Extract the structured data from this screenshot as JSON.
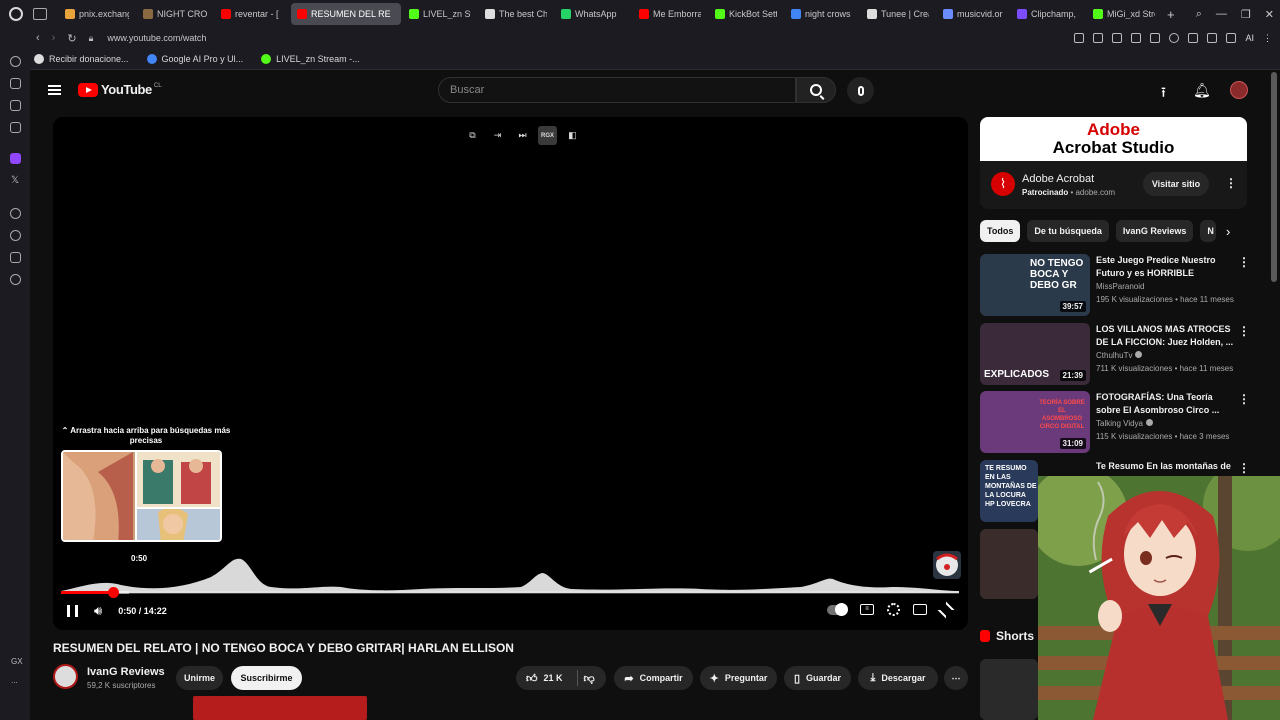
{
  "browser": {
    "tabs": [
      {
        "label": "pnix.exchang",
        "color": "#e8a33d"
      },
      {
        "label": "NIGHT CRO",
        "color": "#8a6a40"
      },
      {
        "label": "reventar - [",
        "color": "#ff0000"
      },
      {
        "label": "RESUMEN DEL RE",
        "color": "#ff0000",
        "active": true
      },
      {
        "label": "LIVEL_zn St",
        "color": "#53fc18"
      },
      {
        "label": "The best Ch",
        "color": "#dddddd"
      },
      {
        "label": "WhatsApp",
        "color": "#25d366"
      },
      {
        "label": "Me Emborra",
        "color": "#ff0000"
      },
      {
        "label": "KickBot Sett",
        "color": "#53fc18"
      },
      {
        "label": "night crows",
        "color": "#4285f4"
      },
      {
        "label": "Tunee | Crea",
        "color": "#dddddd"
      },
      {
        "label": "musicvid.or",
        "color": "#6b8cff"
      },
      {
        "label": "Clipchamp, a",
        "color": "#7b4dff"
      },
      {
        "label": "MiGi_xd Stre",
        "color": "#53fc18"
      }
    ],
    "url": "www.youtube.com/watch",
    "ai_label": "AI",
    "bookmarks": [
      {
        "label": "Recibir donacione...",
        "color": "#dddddd"
      },
      {
        "label": "Google AI Pro y Ul...",
        "color": "#4285f4"
      },
      {
        "label": "LIVEL_zn Stream -...",
        "color": "#53fc18"
      }
    ],
    "sidebar_bottom_label": "GX",
    "sidebar_more": "..."
  },
  "youtube": {
    "logo_text": "YouTube",
    "country_code": "CL",
    "search_placeholder": "Buscar"
  },
  "player": {
    "drag_hint": "⌃ Arrastra hacia arriba para búsquedas más precisas",
    "preview_time": "0:50",
    "current_time": "0:50",
    "duration": "14:22",
    "time_display": "0:50 / 14:22",
    "progress_fraction": 0.058,
    "overlay_badge": "RGX"
  },
  "video": {
    "title": "RESUMEN DEL RELATO | NO TENGO BOCA Y DEBO GRITAR| HARLAN ELLISON",
    "channel_name": "IvanG Reviews",
    "subscribers": "59,2 K suscriptores",
    "join_label": "Unirme",
    "subscribe_label": "Suscribirme",
    "likes": "21 K",
    "share_label": "Compartir",
    "ask_label": "Preguntar",
    "save_label": "Guardar",
    "download_label": "Descargar"
  },
  "ad": {
    "banner_line1": "Adobe",
    "banner_line2": "Acrobat Studio",
    "name": "Adobe Acrobat",
    "sponsored": "Patrocinado",
    "domain": "adobe.com",
    "cta": "Visitar sitio"
  },
  "chips": [
    "Todos",
    "De tu búsqueda",
    "IvanG Reviews",
    "N"
  ],
  "recommendations": [
    {
      "title": "Este Juego Predice Nuestro Futuro y es HORRIBLE",
      "channel": "MissParanoid",
      "verified": false,
      "meta": "195 K visualizaciones • hace 11 meses",
      "duration": "39:57",
      "thumb_text": "NO TENGO BOCA Y DEBO GR"
    },
    {
      "title": "LOS VILLANOS MAS ATROCES DE LA FICCION: Juez Holden, ...",
      "channel": "CthulhuTv",
      "verified": true,
      "meta": "711 K visualizaciones • hace 11 meses",
      "duration": "21:39",
      "thumb_text": "EXPLICADOS"
    },
    {
      "title": "FOTOGRAFÍAS: Una Teoría sobre El Asombroso Circo ...",
      "channel": "Talking Vidya",
      "verified": true,
      "meta": "115 K visualizaciones • hace 3 meses",
      "duration": "31:09",
      "thumb_text": "TEORÍA SOBRE EL ASOMBROSO CIRCO DIGITAL"
    },
    {
      "title": "Te Resumo En las montañas de",
      "channel": "",
      "verified": false,
      "meta": "",
      "duration": "",
      "thumb_text": "TE RESUMO EN LAS MONTAÑAS DE LA LOCURA HP LOVECRA"
    }
  ],
  "shorts_label": "Shorts",
  "colors": {
    "accent": "#ff0000",
    "background": "#0f0f0f",
    "surface": "#272727"
  }
}
